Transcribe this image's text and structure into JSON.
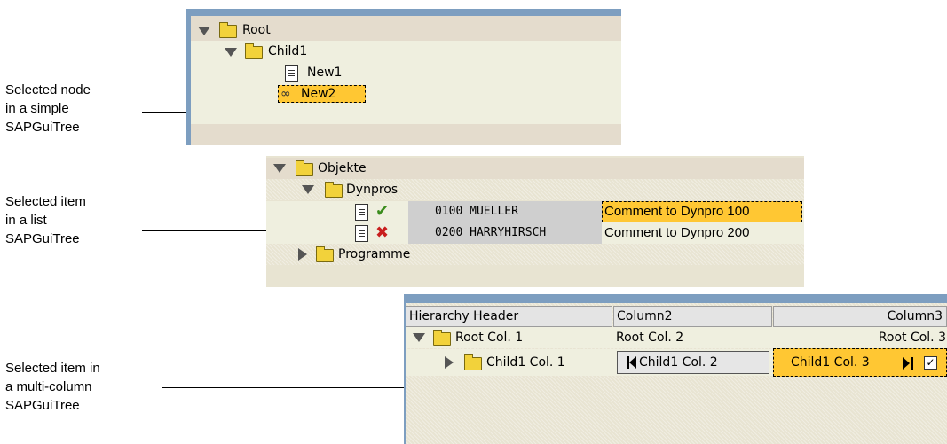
{
  "annotations": [
    {
      "lines": [
        "Selected node",
        "in a simple",
        "SAPGuiTree"
      ]
    },
    {
      "lines": [
        "Selected item",
        "in a list",
        "SAPGuiTree"
      ]
    },
    {
      "lines": [
        "Selected item in",
        "a multi-column",
        "SAPGuiTree"
      ]
    }
  ],
  "simple_tree": {
    "nodes": [
      "Root",
      "Child1",
      "New1",
      "New2"
    ],
    "selected": "New2"
  },
  "list_tree": {
    "folders": [
      "Objekte",
      "Dynpros",
      "Programme"
    ],
    "items": [
      {
        "status": "check-icon",
        "id": "0100 MUELLER",
        "comment": "Comment to Dynpro 100",
        "selected": true
      },
      {
        "status": "cross-icon",
        "id": "0200 HARRYHIRSCH",
        "comment": "Comment to Dynpro 200",
        "selected": false
      }
    ]
  },
  "multi_tree": {
    "headers": [
      "Hierarchy Header",
      "Column2",
      "Column3"
    ],
    "rows": [
      {
        "c1": "Root Col. 1",
        "c2": "Root Col. 2",
        "c3": "Root Col. 3"
      },
      {
        "c1": "Child1 Col. 1",
        "c2": "Child1 Col. 2",
        "c3": "Child1 Col. 3",
        "checked": true
      }
    ]
  },
  "colors": {
    "selection": "#ffc733",
    "title_bar": "#7d9ec0",
    "row_tan": "#e4dccd",
    "row_light": "#efefdf",
    "check_green": "#3a8c1c",
    "cross_red": "#c81e1e"
  }
}
